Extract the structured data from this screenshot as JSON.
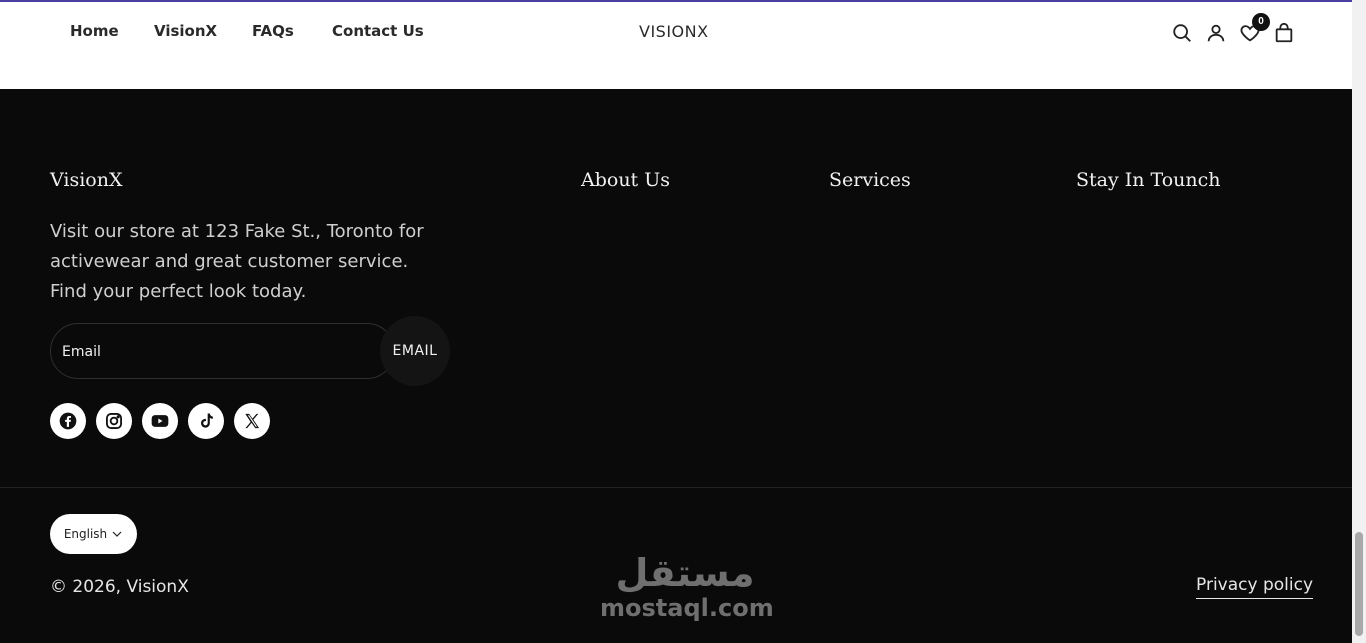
{
  "nav": {
    "links": [
      "Home",
      "VisionX",
      "FAQs",
      "Contact Us"
    ],
    "brand": "VISIONX",
    "wishlist_count": "0",
    "icons": [
      "search-icon",
      "account-icon",
      "wishlist-heart-icon",
      "cart-bag-icon"
    ]
  },
  "footer": {
    "brand": "VisionX",
    "description": "Visit our store at 123 Fake St., Toronto for activewear and great customer service. Find your perfect look today.",
    "email": {
      "placeholder": "Email",
      "button": "EMAIL"
    },
    "socials": [
      "facebook-icon",
      "instagram-icon",
      "youtube-icon",
      "tiktok-icon",
      "x-icon"
    ],
    "columns": [
      "About Us",
      "Services",
      "Stay In Tounch"
    ],
    "language": "English",
    "copyright": "© 2026, VisionX",
    "privacy": "Privacy policy"
  },
  "watermark": {
    "arabic": "مستقل",
    "latin": "mostaql.com"
  },
  "colors": {
    "accent_line": "#4b3fa0",
    "footer_bg": "#0a0a0a",
    "header_bg": "#ffffff"
  }
}
